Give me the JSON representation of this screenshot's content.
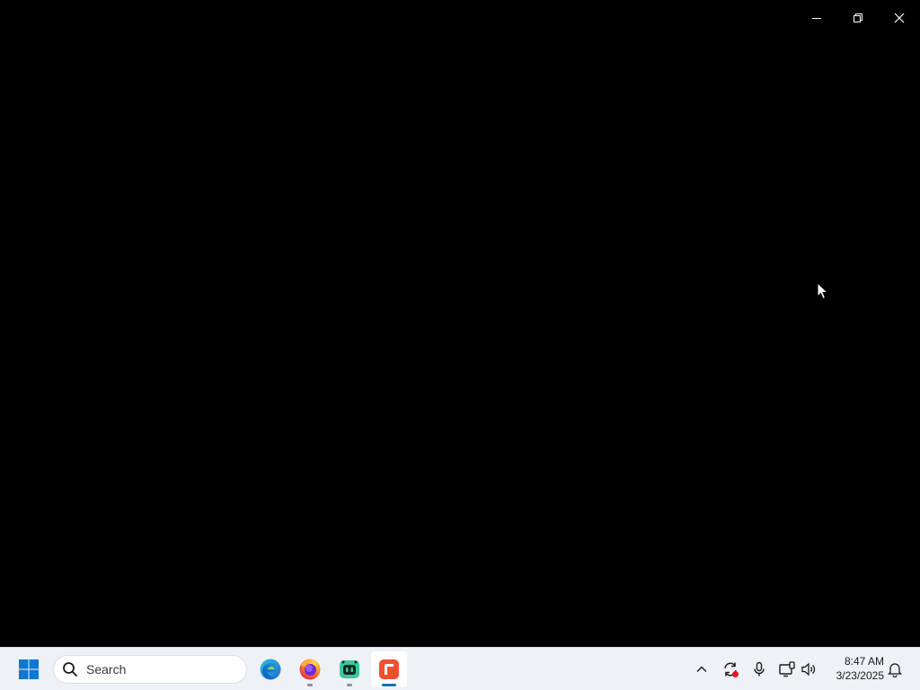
{
  "taskbar": {
    "search_label": "Search",
    "pinned_apps": [
      {
        "name": "Microsoft Edge",
        "icon": "edge-icon",
        "running": false,
        "active": false
      },
      {
        "name": "Firefox",
        "icon": "firefox-icon",
        "running": true,
        "active": false
      },
      {
        "name": "App",
        "icon": "green-app-icon",
        "running": true,
        "active": false
      },
      {
        "name": "App",
        "icon": "orange-app-icon",
        "running": true,
        "active": true
      }
    ],
    "tray": {
      "time": "8:47 AM",
      "date": "3/23/2025"
    }
  },
  "colors": {
    "window_background": "#000000",
    "taskbar_background": "#eef1f5",
    "start_blue": "#0a78d4",
    "active_indicator": "#0b6fb8"
  }
}
